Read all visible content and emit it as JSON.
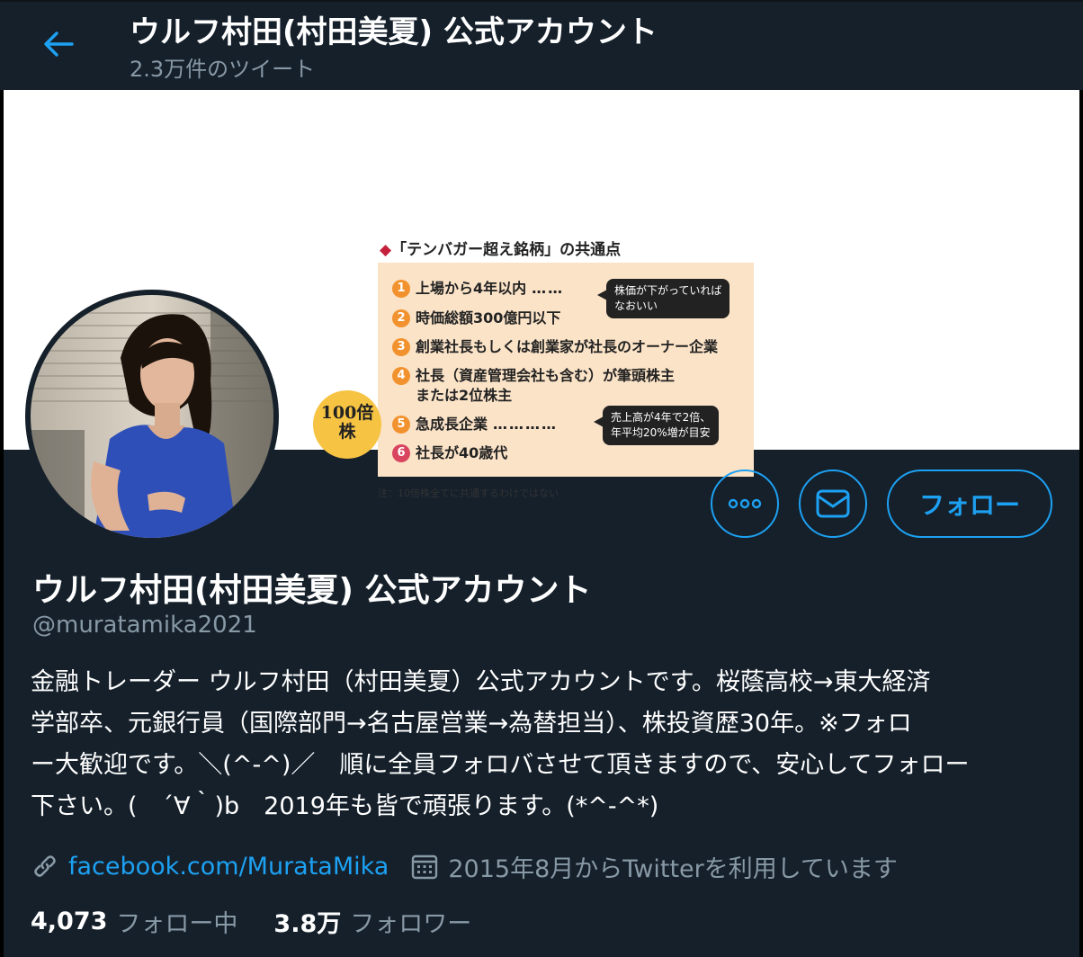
{
  "header": {
    "title": "ウルフ村田(村田美夏) 公式アカウント",
    "tweet_count": "2.3万件のツイート"
  },
  "banner": {
    "title_marker": "◆",
    "title": "「テンバガー超え銘柄」の共通点",
    "items": [
      {
        "num": "1",
        "text": "上場から4年以内",
        "color": "#f2922e"
      },
      {
        "num": "2",
        "text": "時価総額300億円以下",
        "color": "#f2922e"
      },
      {
        "num": "3",
        "text": "創業社長もしくは創業家が社長のオーナー企業",
        "color": "#f2922e"
      },
      {
        "num": "4",
        "text": "社長（資産管理会社も含む）が筆頭株主",
        "text2": "または2位株主",
        "color": "#f2922e"
      },
      {
        "num": "5",
        "text": "急成長企業",
        "color": "#f2922e"
      },
      {
        "num": "6",
        "text": "社長が40歳代",
        "color": "#d9455f"
      }
    ],
    "dots": "……",
    "dots_long": "…………",
    "bubble1_line1": "株価が下がっていれば",
    "bubble1_line2": "なおいい",
    "bubble2_line1": "売上高が4年で2倍、",
    "bubble2_line2": "年平均20%増が目安",
    "badge_line1": "100倍",
    "badge_line2": "株",
    "note": "注：10倍株全てに共通するわけではない"
  },
  "actions": {
    "more_icon": "more-dots-icon",
    "message_icon": "envelope-icon",
    "follow_label": "フォロー"
  },
  "profile": {
    "name": "ウルフ村田(村田美夏) 公式アカウント",
    "handle": "@muratamika2021",
    "bio_lines": [
      "金融トレーダー ウルフ村田（村田美夏）公式アカウントです。桜蔭高校→東大経済",
      "学部卒、元銀行員（国際部門→名古屋営業→為替担当）、株投資歴30年。※フォロ",
      "ー大歓迎です。＼(^-^)／　順に全員フォロバさせて頂きますので、安心してフォロー",
      "下さい。(　´∀｀)b　2019年も皆で頑張ります。(*^-^*)"
    ],
    "link": "facebook.com/MurataMika",
    "joined": "2015年8月からTwitterを利用しています",
    "following_count": "4,073",
    "following_label": "フォロー中",
    "followers_count": "3.8万",
    "followers_label": "フォロワー"
  },
  "colors": {
    "background": "#15202b",
    "accent": "#1da1f2",
    "secondary_text": "#8899a6"
  }
}
